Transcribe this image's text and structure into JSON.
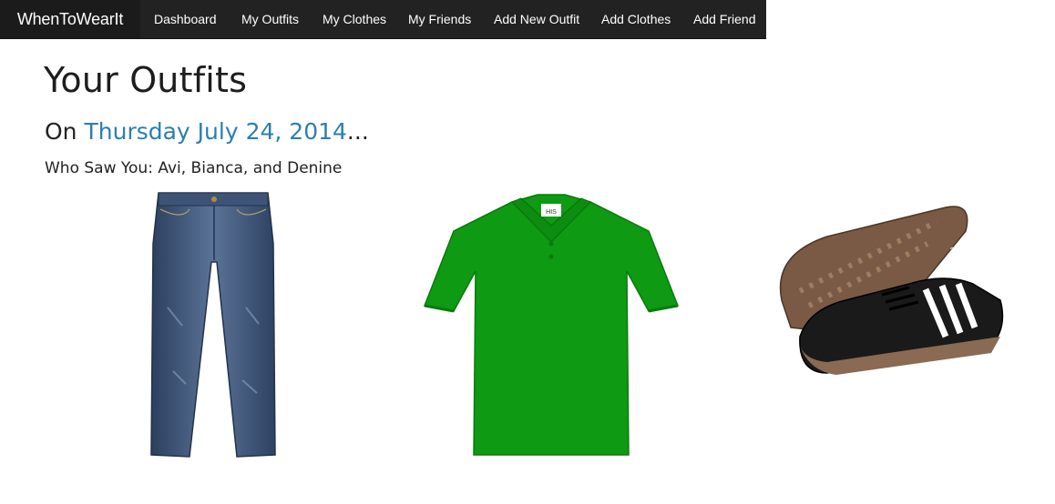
{
  "nav": {
    "brand": "WhenToWearIt",
    "items": [
      {
        "label": "Dashboard"
      },
      {
        "label": "My Outfits"
      },
      {
        "label": "My Clothes"
      },
      {
        "label": "My Friends"
      },
      {
        "label": "Add New Outfit"
      },
      {
        "label": "Add Clothes"
      },
      {
        "label": "Add Friend"
      }
    ]
  },
  "page": {
    "title": "Your Outfits",
    "date_prefix": "On ",
    "date": "Thursday July 24, 2014",
    "date_suffix": "...",
    "seen_by": "Who Saw You: Avi, Bianca, and Denine"
  },
  "outfit": {
    "items": [
      {
        "kind": "jeans",
        "color": "#3a5275"
      },
      {
        "kind": "polo-shirt",
        "color": "#0e9a12",
        "tag_text": "HIS"
      },
      {
        "kind": "sneakers",
        "color": "#1a1a1a",
        "brand_text": "adidas"
      }
    ]
  }
}
